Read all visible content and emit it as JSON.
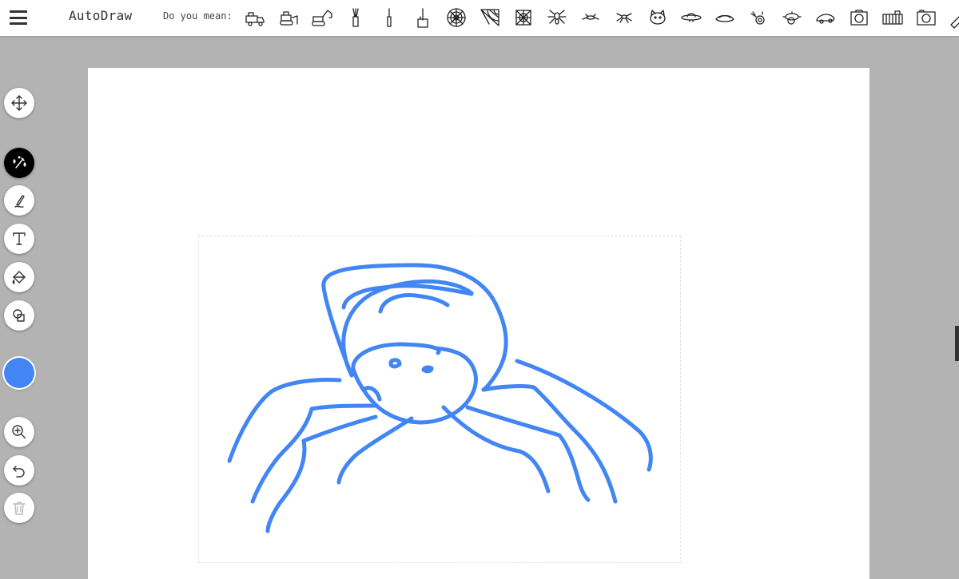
{
  "app": {
    "title": "AutoDraw"
  },
  "header": {
    "suggest_label": "Do you mean:",
    "suggestions": [
      "toy-truck-icon",
      "bulldozer-icon",
      "excavator-icon",
      "brush-icon",
      "pen-icon",
      "tool-icon",
      "spider-web-icon",
      "spider-web-corner-icon",
      "spider-web-small-icon",
      "spider-icon",
      "bug-icon",
      "spider-small-icon",
      "cat-face-icon",
      "flying-saucer-icon",
      "hat-icon",
      "camera-vintage-icon",
      "cannon-icon",
      "car-icon",
      "camera-icon",
      "building-icon",
      "photo-camera-icon",
      "paint-brush-icon"
    ]
  },
  "toolbar": {
    "tools": [
      {
        "name": "move-tool",
        "icon": "move-icon",
        "active": false
      },
      {
        "name": "autodraw-tool",
        "icon": "autodraw-sparkle-icon",
        "active": true
      },
      {
        "name": "draw-tool",
        "icon": "pencil-icon",
        "active": false
      },
      {
        "name": "type-tool",
        "icon": "text-icon",
        "active": false
      },
      {
        "name": "fill-tool",
        "icon": "paint-bucket-icon",
        "active": false
      },
      {
        "name": "shape-tool",
        "icon": "shapes-icon",
        "active": false
      },
      {
        "name": "zoom-tool",
        "icon": "zoom-in-icon",
        "active": false
      },
      {
        "name": "undo-tool",
        "icon": "undo-icon",
        "active": false
      },
      {
        "name": "delete-tool",
        "icon": "trash-icon",
        "active": false,
        "disabled": true
      }
    ],
    "selected_color": "#4285f4"
  },
  "colors": {
    "stroke": "#4285f4",
    "background": "#b3b3b3",
    "canvas": "#ffffff"
  }
}
